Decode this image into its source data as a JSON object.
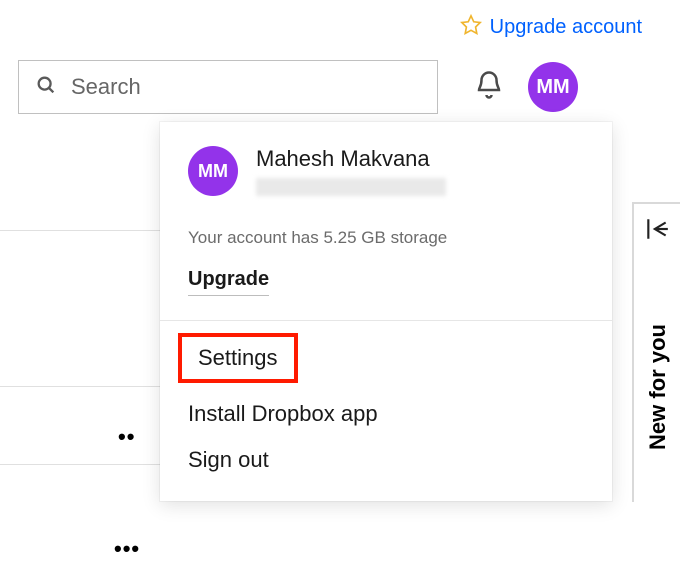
{
  "top": {
    "upgrade_link": "Upgrade account"
  },
  "search": {
    "placeholder": "Search"
  },
  "avatar": {
    "initials": "MM"
  },
  "dropdown": {
    "user_name": "Mahesh Makvana",
    "avatar_initials": "MM",
    "storage_text": "Your account has 5.25 GB storage",
    "upgrade_label": "Upgrade",
    "items": {
      "settings": "Settings",
      "install": "Install Dropbox app",
      "signout": "Sign out"
    }
  },
  "side": {
    "label": "New for you"
  }
}
